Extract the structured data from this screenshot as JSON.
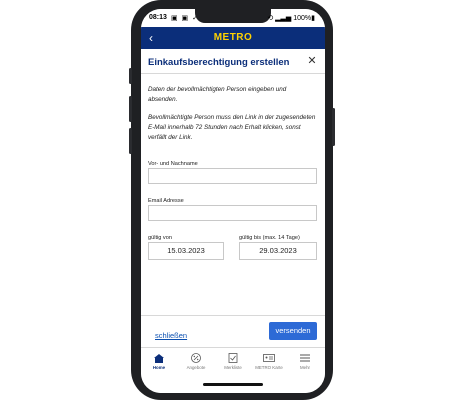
{
  "status_bar": {
    "time": "08:13",
    "left_icons": "▣ ▣ ✓",
    "right": "⟲ ▂▃▅ 100%▮"
  },
  "header": {
    "logo_text": "METRO"
  },
  "dialog": {
    "title": "Einkaufsberechtigung erstellen",
    "intro": "Daten der bevollmächtigten Person eingeben und absenden.",
    "note": "Bevollmächtigte Person muss den Link in der zugesendeten E-Mail innerhalb 72 Stunden nach Erhalt klicken, sonst verfällt der Link.",
    "name_label": "Vor- und Nachname",
    "name_value": "",
    "email_label": "Email Adresse",
    "email_value": "",
    "valid_from_label": "gültig von",
    "valid_from_value": "15.03.2023",
    "valid_to_label": "gültig bis (max. 14 Tage)",
    "valid_to_value": "29.03.2023",
    "close_link": "schließen",
    "send_button": "versenden"
  },
  "tabs": [
    {
      "label": "Home",
      "icon": "home-icon",
      "active": true
    },
    {
      "label": "Angebote",
      "icon": "percent-icon",
      "active": false
    },
    {
      "label": "Merkliste",
      "icon": "checklist-icon",
      "active": false
    },
    {
      "label": "METRO Karte",
      "icon": "card-icon",
      "active": false
    },
    {
      "label": "Mehr",
      "icon": "menu-icon",
      "active": false
    }
  ],
  "colors": {
    "brand_blue": "#0b2e7a",
    "logo_yellow": "#ffd200",
    "button_blue": "#2d6ad6"
  }
}
